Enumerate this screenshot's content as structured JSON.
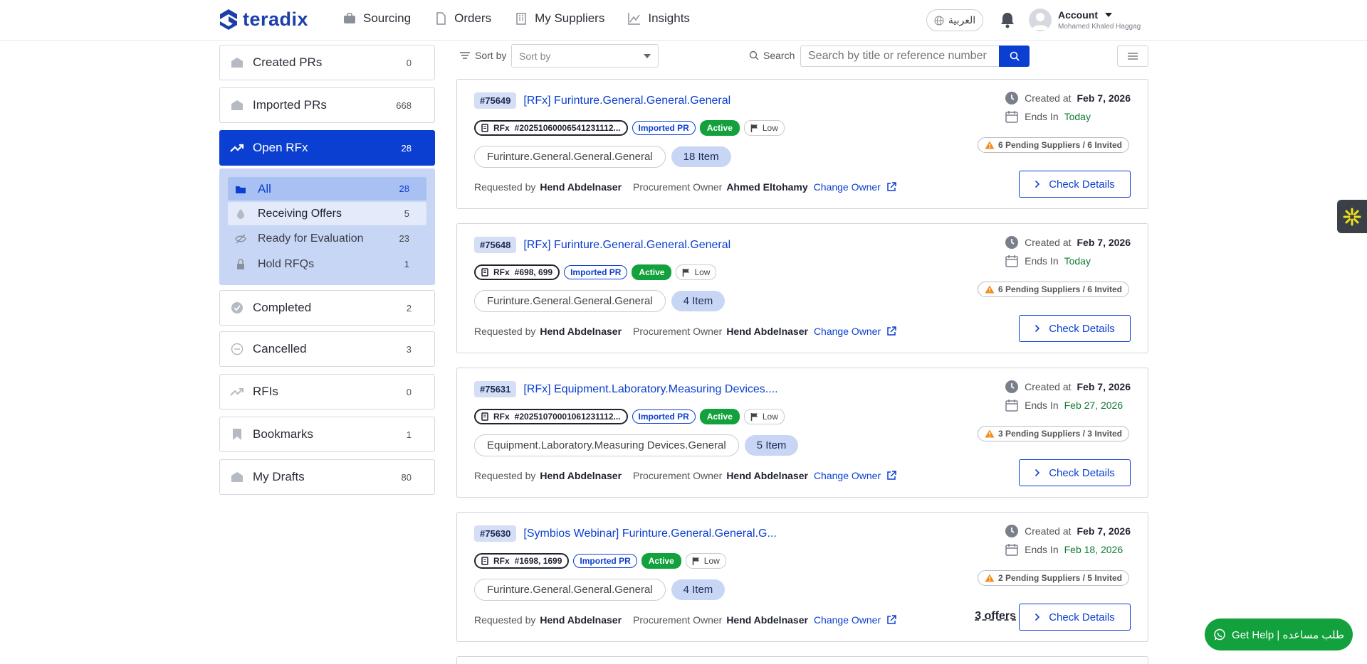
{
  "header": {
    "logo_text": "teradix",
    "nav": [
      "Sourcing",
      "Orders",
      "My Suppliers",
      "Insights"
    ],
    "lang": "العربية",
    "account_label": "Account",
    "account_name": "Mohamed Khaled Haggag"
  },
  "sidebar": {
    "items": [
      {
        "label": "Created PRs",
        "count": "0"
      },
      {
        "label": "Imported PRs",
        "count": "668"
      },
      {
        "label": "Open RFx",
        "count": "28"
      },
      {
        "label": "Completed",
        "count": "2"
      },
      {
        "label": "Cancelled",
        "count": "3"
      },
      {
        "label": "RFIs",
        "count": "0"
      },
      {
        "label": "Bookmarks",
        "count": "1"
      },
      {
        "label": "My Drafts",
        "count": "80"
      }
    ],
    "sub_items": [
      {
        "label": "All",
        "count": "28"
      },
      {
        "label": "Receiving Offers",
        "count": "5"
      },
      {
        "label": "Ready for Evaluation",
        "count": "23"
      },
      {
        "label": "Hold RFQs",
        "count": "1"
      }
    ]
  },
  "toolbar": {
    "sort_label": "Sort by",
    "sort_placeholder": "Sort by",
    "search_label": "Search",
    "search_placeholder": "Search by title or reference number"
  },
  "labels": {
    "created_at": "Created at",
    "ends_in": "Ends In",
    "requested_by": "Requested by",
    "procurement_owner": "Procurement Owner",
    "change_owner": "Change Owner",
    "check_details": "Check Details",
    "rfx": "RFx",
    "imported_pr": "Imported PR",
    "active": "Active",
    "low": "Low"
  },
  "cards": [
    {
      "id": "#75649",
      "title": "[RFx] Furinture.General.General.General",
      "ref": "#20251060006541231112...",
      "category": "Furinture.General.General.General",
      "items": "18 Item",
      "requested_by": "Hend Abdelnaser",
      "owner": "Ahmed Eltohamy",
      "created": "Feb 7, 2026",
      "ends": "Today",
      "pending": "6 Pending Suppliers / 6 Invited",
      "offers": ""
    },
    {
      "id": "#75648",
      "title": "[RFx] Furinture.General.General.General",
      "ref": "#698, 699",
      "category": "Furinture.General.General.General",
      "items": "4 Item",
      "requested_by": "Hend Abdelnaser",
      "owner": "Hend Abdelnaser",
      "created": "Feb 7, 2026",
      "ends": "Today",
      "pending": "6 Pending Suppliers / 6 Invited",
      "offers": ""
    },
    {
      "id": "#75631",
      "title": "[RFx] Equipment.Laboratory.Measuring Devices....",
      "ref": "#20251070001061231112...",
      "category": "Equipment.Laboratory.Measuring Devices.General",
      "items": "5 Item",
      "requested_by": "Hend Abdelnaser",
      "owner": "Hend Abdelnaser",
      "created": "Feb 7, 2026",
      "ends": "Feb 27, 2026",
      "pending": "3 Pending Suppliers / 3 Invited",
      "offers": ""
    },
    {
      "id": "#75630",
      "title": "[Symbios Webinar] Furinture.General.General.G...",
      "ref": "#1698, 1699",
      "category": "Furinture.General.General.General",
      "items": "4 Item",
      "requested_by": "Hend Abdelnaser",
      "owner": "Hend Abdelnaser",
      "created": "Feb 7, 2026",
      "ends": "Feb 18, 2026",
      "pending": "2 Pending Suppliers / 5 Invited",
      "offers": "3 offers"
    }
  ],
  "help": "Get Help | طلب مساعده",
  "colors": {
    "primary": "#0b3fd1",
    "active_green": "#12a13c",
    "sub_panel": "#c8d6f5"
  }
}
